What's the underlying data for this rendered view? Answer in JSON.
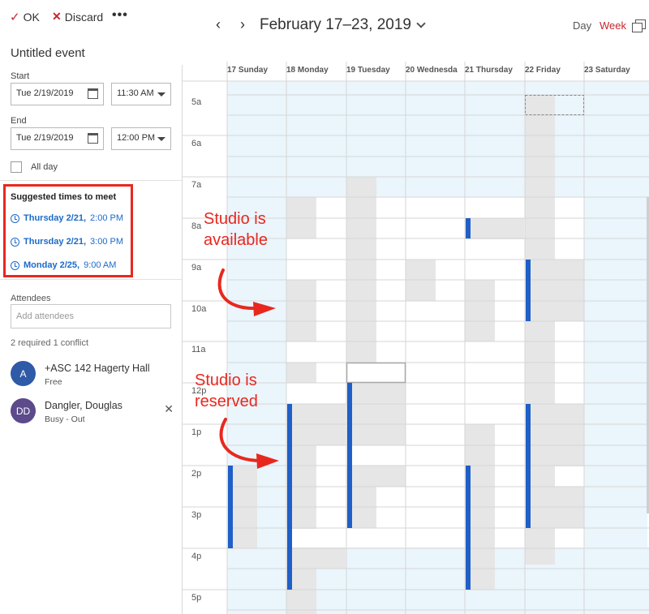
{
  "toolbar": {
    "ok_label": "OK",
    "discard_label": "Discard",
    "more_label": "•••"
  },
  "event": {
    "title": "Untitled event",
    "start_label": "Start",
    "start_date": "Tue 2/19/2019",
    "start_time": "11:30 AM",
    "end_label": "End",
    "end_date": "Tue 2/19/2019",
    "end_time": "12:00 PM",
    "all_day_label": "All day"
  },
  "suggestions": {
    "title": "Suggested times to meet",
    "items": [
      {
        "day": "Thursday 2/21,",
        "time": "2:00 PM"
      },
      {
        "day": "Thursday 2/21,",
        "time": "3:00 PM"
      },
      {
        "day": "Monday 2/25,",
        "time": "9:00 AM"
      }
    ]
  },
  "attendees": {
    "label": "Attendees",
    "placeholder": "Add attendees",
    "status": "2 required 1 conflict",
    "people": [
      {
        "initials": "A",
        "name": "+ASC 142 Hagerty Hall",
        "status": "Free",
        "color": "#2e5aa8"
      },
      {
        "initials": "DD",
        "name": "Dangler, Douglas",
        "status": "Busy - Out",
        "color": "#5c4a8a",
        "remove": "✕"
      }
    ]
  },
  "calendar": {
    "prev": "‹",
    "next": "›",
    "range": "February 17–23, 2019",
    "view_day": "Day",
    "view_week": "Week",
    "days": [
      "17 Sunday",
      "18 Monday",
      "19 Tuesday",
      "20 Wednesda",
      "21 Thursday",
      "22 Friday",
      "23 Saturday"
    ],
    "hours": [
      "5a",
      "6a",
      "7a",
      "8a",
      "9a",
      "10a",
      "11a",
      "12p",
      "1p",
      "2p",
      "3p",
      "4p",
      "5p"
    ]
  },
  "annotations": {
    "available_line1": "Studio is",
    "available_line2": "available",
    "reserved_line1": "Studio is",
    "reserved_line2": "reserved"
  },
  "colors": {
    "accent": "#c4262e",
    "link": "#1b6ac9",
    "busy_bar": "#1f5fc8",
    "busy_gray": "#e6e6e6",
    "weekend_blue": "#eaf5fc",
    "annotation": "#e8281f"
  }
}
